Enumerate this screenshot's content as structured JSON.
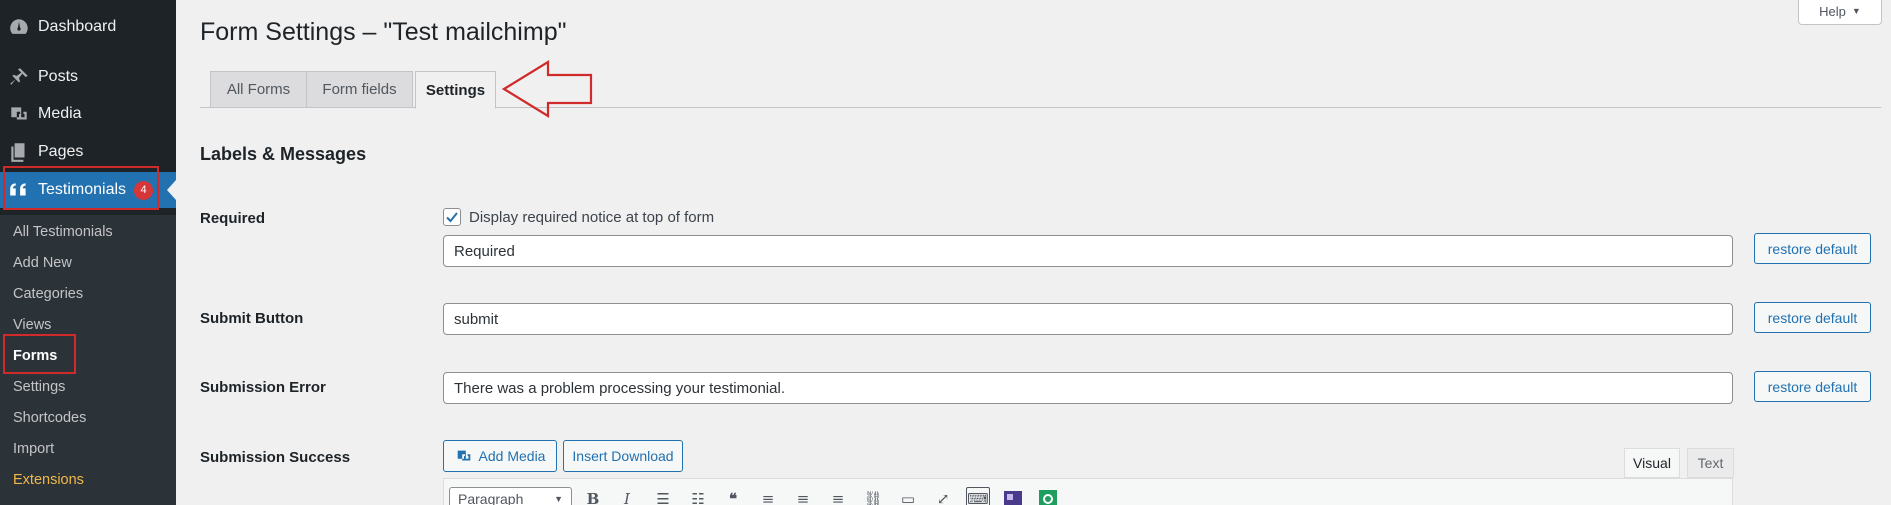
{
  "sidebar": {
    "menu": {
      "dashboard": "Dashboard",
      "posts": "Posts",
      "media": "Media",
      "pages": "Pages",
      "testimonials": "Testimonials",
      "testimonials_badge": "4"
    },
    "submenu": {
      "all_testimonials": "All Testimonials",
      "add_new": "Add New",
      "categories": "Categories",
      "views": "Views",
      "forms": "Forms",
      "settings": "Settings",
      "shortcodes": "Shortcodes",
      "import": "Import",
      "extensions": "Extensions"
    }
  },
  "header": {
    "title": "Form Settings – \"Test mailchimp\"",
    "help": "Help",
    "help_icon": "caret-down-icon"
  },
  "tabs": {
    "all_forms": "All Forms",
    "form_fields": "Form fields",
    "settings": "Settings"
  },
  "section": {
    "title": "Labels & Messages"
  },
  "fields": {
    "required": {
      "label": "Required",
      "checkbox_label": "Display required notice at top of form",
      "checked": true,
      "value": "Required"
    },
    "submit_button": {
      "label": "Submit Button",
      "value": "submit"
    },
    "submission_error": {
      "label": "Submission Error",
      "value": "There was a problem processing your testimonial."
    },
    "submission_success": {
      "label": "Submission Success"
    },
    "restore_default": "restore default"
  },
  "editor": {
    "add_media": "Add Media",
    "insert_download": "Insert Download",
    "tab_visual": "Visual",
    "tab_text": "Text",
    "format": "Paragraph"
  },
  "colors": {
    "sidebar_bg": "#1d2327",
    "accent": "#2271b1",
    "highlight_red": "#d02a2a",
    "badge_red": "#d63638"
  }
}
